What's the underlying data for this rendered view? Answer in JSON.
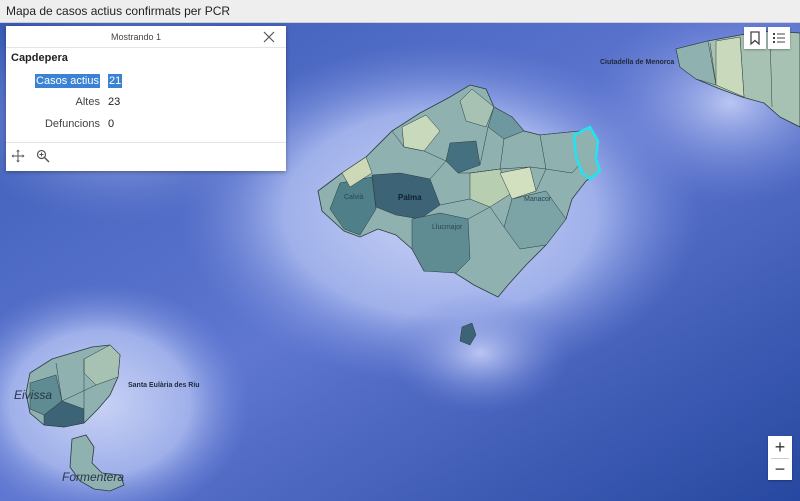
{
  "window": {
    "title": "Mapa de casos actius confirmats per PCR"
  },
  "popup": {
    "count_label": "Mostrando 1",
    "title": "Capdepera",
    "fields": [
      {
        "label": "Casos actius",
        "value": "21"
      },
      {
        "label": "Altes",
        "value": "23"
      },
      {
        "label": "Defuncions",
        "value": "0"
      }
    ],
    "footer_icons": [
      "move-icon",
      "zoom-to-icon"
    ]
  },
  "map": {
    "labels": {
      "ciutadella": "Ciutadella de Menorca",
      "santa_eularia": "Santa Eulària des Riu",
      "eivissa": "Eivissa",
      "formentera": "Formentera",
      "palma": "Palma",
      "llucmajor": "Llucmajor",
      "manacor": "Manacor",
      "calvia": "Calvià"
    },
    "selected_region": "Capdepera",
    "colors": {
      "sea_deep": "#2b4fa0",
      "sea_shallow": "#aab7ee",
      "land_light": "#c9d9bb",
      "land_mid": "#7fa7a7",
      "land_dark": "#3d6376",
      "highlight": "#22e3f2"
    }
  },
  "controls": {
    "zoom_in": "+",
    "zoom_out": "−",
    "icons": [
      "bookmark-icon",
      "legend-icon"
    ]
  }
}
